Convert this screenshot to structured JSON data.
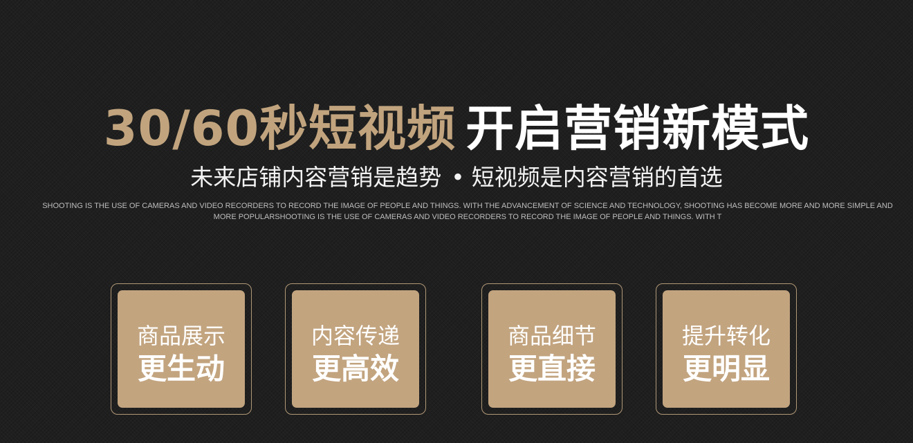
{
  "headline": {
    "gold_text": "30/60秒短视频",
    "white_text": "开启营销新模式"
  },
  "subtitle": {
    "left": "未来店铺内容营销是趋势",
    "dot": "•",
    "right": "短视频是内容营销的首选"
  },
  "english_paragraph": "SHOOTING IS THE USE OF CAMERAS AND VIDEO RECORDERS TO RECORD THE IMAGE OF PEOPLE AND THINGS. WITH THE ADVANCEMENT OF SCIENCE AND TECHNOLOGY, SHOOTING HAS BECOME MORE AND MORE SIMPLE AND MORE POPULARSHOOTING IS THE USE OF CAMERAS AND VIDEO RECORDERS TO RECORD THE IMAGE OF PEOPLE AND THINGS. WITH T",
  "cards": [
    {
      "line1": "商品展示",
      "line2": "更生动"
    },
    {
      "line1": "内容传递",
      "line2": "更高效"
    },
    {
      "line1": "商品细节",
      "line2": "更直接"
    },
    {
      "line1": "提升转化",
      "line2": "更明显"
    }
  ],
  "colors": {
    "background": "#1f1f1f",
    "gold": "#c1a47e",
    "card_fill": "#c2a47f",
    "card_border": "#b29a78",
    "text_light": "#ffffff"
  }
}
